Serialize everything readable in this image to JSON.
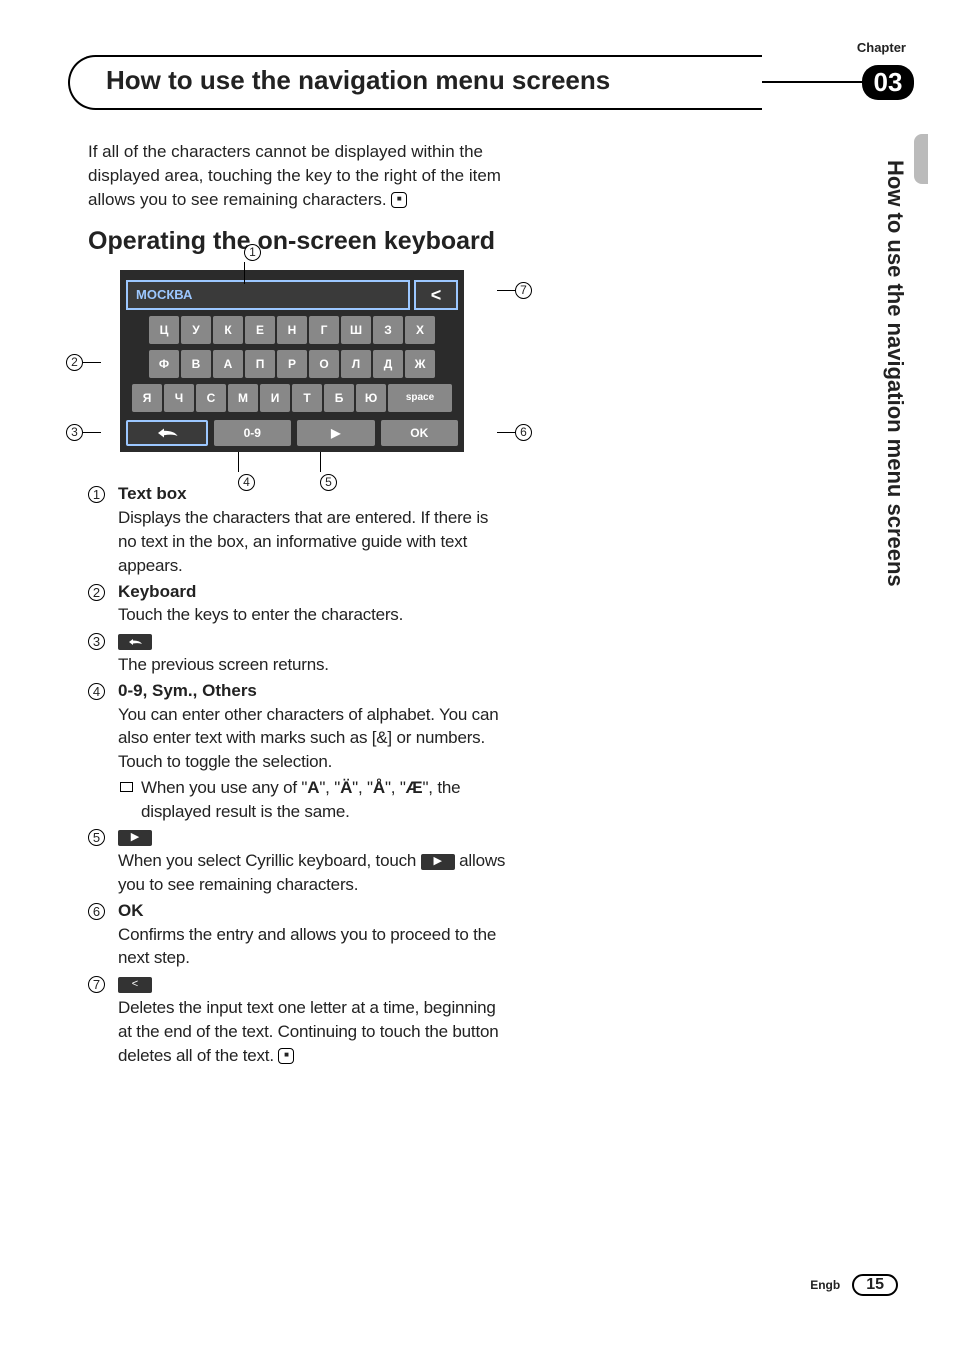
{
  "header": {
    "chapter_label": "Chapter",
    "chapter_num": "03",
    "title": "How to use the navigation menu screens"
  },
  "side": {
    "vertical_title": "How to use the navigation menu screens"
  },
  "intro": "If all of the characters cannot be displayed within the displayed area, touching the key to the right of the item allows you to see remaining characters.",
  "h2": "Operating the on-screen keyboard",
  "kbd": {
    "textbox_value": "МОСКВА",
    "delete_glyph": "<",
    "row1": [
      "Ц",
      "У",
      "К",
      "Е",
      "Н",
      "Г",
      "Ш",
      "З",
      "Х"
    ],
    "row2": [
      "Ф",
      "В",
      "А",
      "П",
      "Р",
      "О",
      "Л",
      "Д",
      "Ж"
    ],
    "row3": [
      "Я",
      "Ч",
      "С",
      "М",
      "И",
      "Т",
      "Б",
      "Ю"
    ],
    "space_label": "space",
    "btn_09": "0-9",
    "btn_more": "▶",
    "btn_ok": "OK"
  },
  "callouts": {
    "1": "1",
    "2": "2",
    "3": "3",
    "4": "4",
    "5": "5",
    "6": "6",
    "7": "7"
  },
  "items": [
    {
      "num": "1",
      "title": "Text box",
      "desc": "Displays the characters that are entered. If there is no text in the box, an informative guide with text appears."
    },
    {
      "num": "2",
      "title": "Keyboard",
      "desc": "Touch the keys to enter the characters."
    },
    {
      "num": "3",
      "icon": "back",
      "desc": "The previous screen returns."
    },
    {
      "num": "4",
      "title": "0-9, Sym., Others",
      "desc": "You can enter other characters of alphabet. You can also enter text with marks such as [&] or numbers.\nTouch to toggle the selection.",
      "note_pre": "When you use any of \"",
      "note_chars": [
        "A",
        "Ä",
        "Å",
        "Æ"
      ],
      "note_mid": "\", \"",
      "note_post": "\", the displayed result is the same."
    },
    {
      "num": "5",
      "icon": "more",
      "desc_pre": "When you select Cyrillic keyboard, touch ",
      "desc_post": " allows you to see remaining characters."
    },
    {
      "num": "6",
      "title": "OK",
      "desc": "Confirms the entry and allows you to proceed to the next step."
    },
    {
      "num": "7",
      "icon": "del",
      "desc": "Deletes the input text one letter at a time, beginning at the end of the text. Continuing to touch the button deletes all of the text."
    }
  ],
  "footer": {
    "lang": "Engb",
    "page": "15"
  }
}
